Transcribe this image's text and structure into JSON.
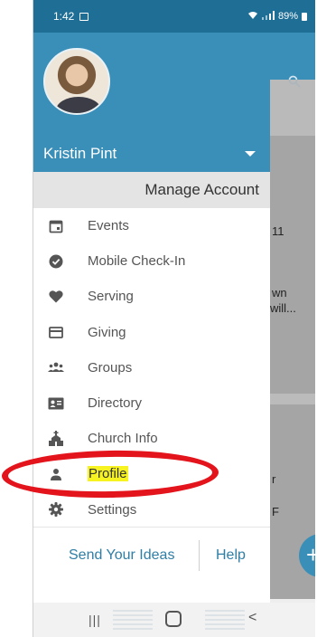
{
  "status_bar": {
    "time": "1:42",
    "battery": "89%"
  },
  "account": {
    "name": "Kristin Pint",
    "manage_label": "Manage Account"
  },
  "menu": [
    {
      "label": "Events",
      "icon": "calendar-icon"
    },
    {
      "label": "Mobile Check-In",
      "icon": "check-circle-icon"
    },
    {
      "label": "Serving",
      "icon": "heart-icon"
    },
    {
      "label": "Giving",
      "icon": "credit-card-icon"
    },
    {
      "label": "Groups",
      "icon": "group-icon"
    },
    {
      "label": "Directory",
      "icon": "contact-card-icon"
    },
    {
      "label": "Church Info",
      "icon": "church-icon"
    },
    {
      "label": "Profile",
      "icon": "person-icon",
      "highlighted": true
    },
    {
      "label": "Settings",
      "icon": "gear-icon"
    }
  ],
  "footer": {
    "ideas_label": "Send Your Ideas",
    "help_label": "Help"
  },
  "background": {
    "text_1": "11",
    "text_2": "wn",
    "text_3": " will...",
    "text_4": "r",
    "text_5": "F"
  },
  "colors": {
    "header": "#3a8fb9",
    "status_bar": "#1f6e95",
    "highlight": "#f7f321",
    "annotation": "#e3141b"
  }
}
